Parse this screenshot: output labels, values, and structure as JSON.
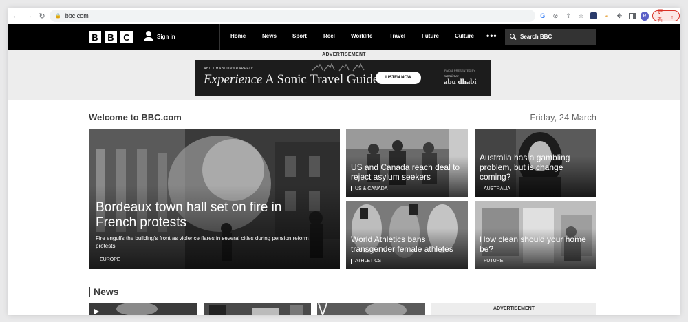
{
  "browser": {
    "url": "bbc.com",
    "update_label": "更新",
    "profile_initial": "R"
  },
  "header": {
    "logo_letters": [
      "B",
      "B",
      "C"
    ],
    "signin_label": "Sign in",
    "nav": [
      "Home",
      "News",
      "Sport",
      "Reel",
      "Worklife",
      "Travel",
      "Future",
      "Culture"
    ],
    "more_label": "•••",
    "search_placeholder": "Search BBC"
  },
  "ad": {
    "label": "ADVERTISEMENT",
    "small_text": "ABU DHABI UNWRAPPED:",
    "headline_italic": "Experience",
    "headline_rest": " A Sonic Travel Guide",
    "cta": "LISTEN NOW",
    "sponsor_small": "PAID & PRESENTED BY",
    "sponsor_top": "experience",
    "sponsor_name": "abu dhabi"
  },
  "main": {
    "welcome": "Welcome to BBC.com",
    "date": "Friday, 24 March",
    "lead": {
      "title": "Bordeaux town hall set on fire in French protests",
      "summary": "Fire engulfs the building's front as violence flares in several cities during pension reform protests.",
      "tag": "EUROPE"
    },
    "stories": [
      {
        "title": "US and Canada reach deal to reject asylum seekers",
        "tag": "US & CANADA"
      },
      {
        "title": "Australia has a gambling problem, but is change coming?",
        "tag": "AUSTRALIA"
      },
      {
        "title": "World Athletics bans transgender female athletes",
        "tag": "ATHLETICS"
      },
      {
        "title": "How clean should your home be?",
        "tag": "FUTURE"
      }
    ],
    "news_heading": "News",
    "ad2_label": "ADVERTISEMENT"
  },
  "colors": {
    "header_bg": "#000000",
    "search_bg": "#333333",
    "ad_band_bg": "#ededed",
    "update_accent": "#d93025"
  }
}
